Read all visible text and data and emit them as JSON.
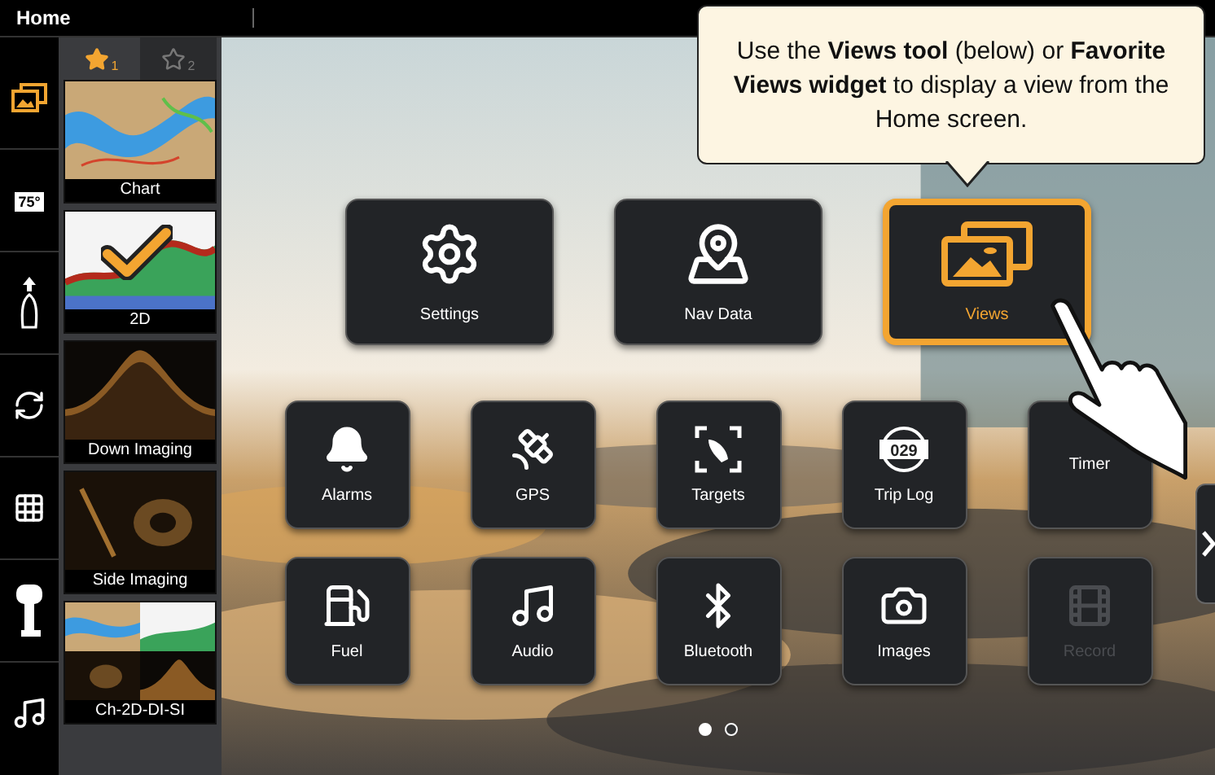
{
  "title": "Home",
  "rail": [
    {
      "selected": true
    },
    {
      "selected": false,
      "text": "75°"
    },
    {
      "selected": false
    },
    {
      "selected": false
    },
    {
      "selected": false
    },
    {
      "selected": false
    },
    {
      "selected": false
    }
  ],
  "favorite_tabs": [
    {
      "number": "1",
      "selected": true
    },
    {
      "number": "2",
      "selected": false
    }
  ],
  "views": [
    {
      "label": "Chart",
      "checked": false
    },
    {
      "label": "2D",
      "checked": true
    },
    {
      "label": "Down Imaging",
      "checked": false
    },
    {
      "label": "Side Imaging",
      "checked": false
    },
    {
      "label": "Ch-2D-DI-SI",
      "checked": false
    }
  ],
  "tile_rows": [
    {
      "kind": "large",
      "tiles": [
        {
          "label": "Settings",
          "selected": false,
          "disabled": false
        },
        {
          "label": "Nav Data",
          "selected": false,
          "disabled": false
        },
        {
          "label": "Views",
          "selected": true,
          "disabled": false
        }
      ]
    },
    {
      "kind": "small",
      "tiles": [
        {
          "label": "Alarms",
          "selected": false,
          "disabled": false
        },
        {
          "label": "GPS",
          "selected": false,
          "disabled": false
        },
        {
          "label": "Targets",
          "selected": false,
          "disabled": false
        },
        {
          "label": "Trip Log",
          "selected": false,
          "disabled": false,
          "digits": "029"
        },
        {
          "label": "Timer",
          "selected": false,
          "disabled": false
        }
      ]
    },
    {
      "kind": "small",
      "tiles": [
        {
          "label": "Fuel",
          "selected": false,
          "disabled": false
        },
        {
          "label": "Audio",
          "selected": false,
          "disabled": false
        },
        {
          "label": "Bluetooth",
          "selected": false,
          "disabled": false
        },
        {
          "label": "Images",
          "selected": false,
          "disabled": false
        },
        {
          "label": "Record",
          "selected": false,
          "disabled": true
        }
      ]
    }
  ],
  "page_dots": [
    {
      "selected": true
    },
    {
      "selected": false
    }
  ],
  "callout": "Use the **Views tool** (below) or **Favorite Views widget** to display a view from the Home screen."
}
